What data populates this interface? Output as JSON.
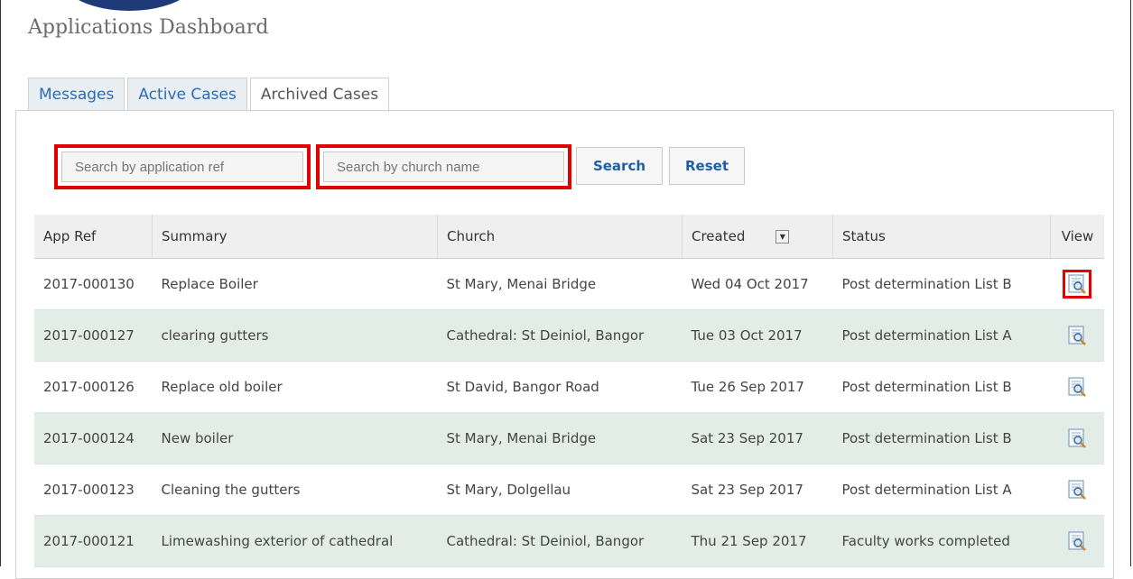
{
  "header": {
    "title": "Applications Dashboard"
  },
  "tabs": [
    {
      "label": "Messages",
      "active": false
    },
    {
      "label": "Active Cases",
      "active": false
    },
    {
      "label": "Archived Cases",
      "active": true
    }
  ],
  "search": {
    "app_ref_placeholder": "Search by application ref",
    "app_ref_value": "",
    "church_placeholder": "Search by church name",
    "church_value": "",
    "search_label": "Search",
    "reset_label": "Reset"
  },
  "table": {
    "columns": [
      "App Ref",
      "Summary",
      "Church",
      "Created",
      "Status",
      "View"
    ],
    "sort_icon": "dropdown-arrow-icon",
    "rows": [
      {
        "ref": "2017-000130",
        "summary": "Replace Boiler",
        "church": "St Mary, Menai Bridge",
        "created": "Wed 04 Oct 2017",
        "status": "Post determination List B",
        "view_icon": "magnifier-document-icon"
      },
      {
        "ref": "2017-000127",
        "summary": "clearing gutters",
        "church": "Cathedral: St Deiniol, Bangor",
        "created": "Tue 03 Oct 2017",
        "status": "Post determination List A",
        "view_icon": "magnifier-document-icon"
      },
      {
        "ref": "2017-000126",
        "summary": "Replace old boiler",
        "church": "St David, Bangor Road",
        "created": "Tue 26 Sep 2017",
        "status": "Post determination List B",
        "view_icon": "magnifier-document-icon"
      },
      {
        "ref": "2017-000124",
        "summary": "New boiler",
        "church": "St Mary, Menai Bridge",
        "created": "Sat 23 Sep 2017",
        "status": "Post determination List B",
        "view_icon": "magnifier-document-icon"
      },
      {
        "ref": "2017-000123",
        "summary": "Cleaning the gutters",
        "church": "St Mary, Dolgellau",
        "created": "Sat 23 Sep 2017",
        "status": "Post determination List A",
        "view_icon": "magnifier-document-icon"
      },
      {
        "ref": "2017-000121",
        "summary": "Limewashing exterior of cathedral",
        "church": "Cathedral: St Deiniol, Bangor",
        "created": "Thu 21 Sep 2017",
        "status": "Faculty works completed",
        "view_icon": "magnifier-document-icon"
      }
    ]
  },
  "colors": {
    "highlight": "#e30000",
    "tab_link": "#2a6cb3",
    "alt_row": "#e2ede8",
    "button_text": "#1f5fa8"
  }
}
